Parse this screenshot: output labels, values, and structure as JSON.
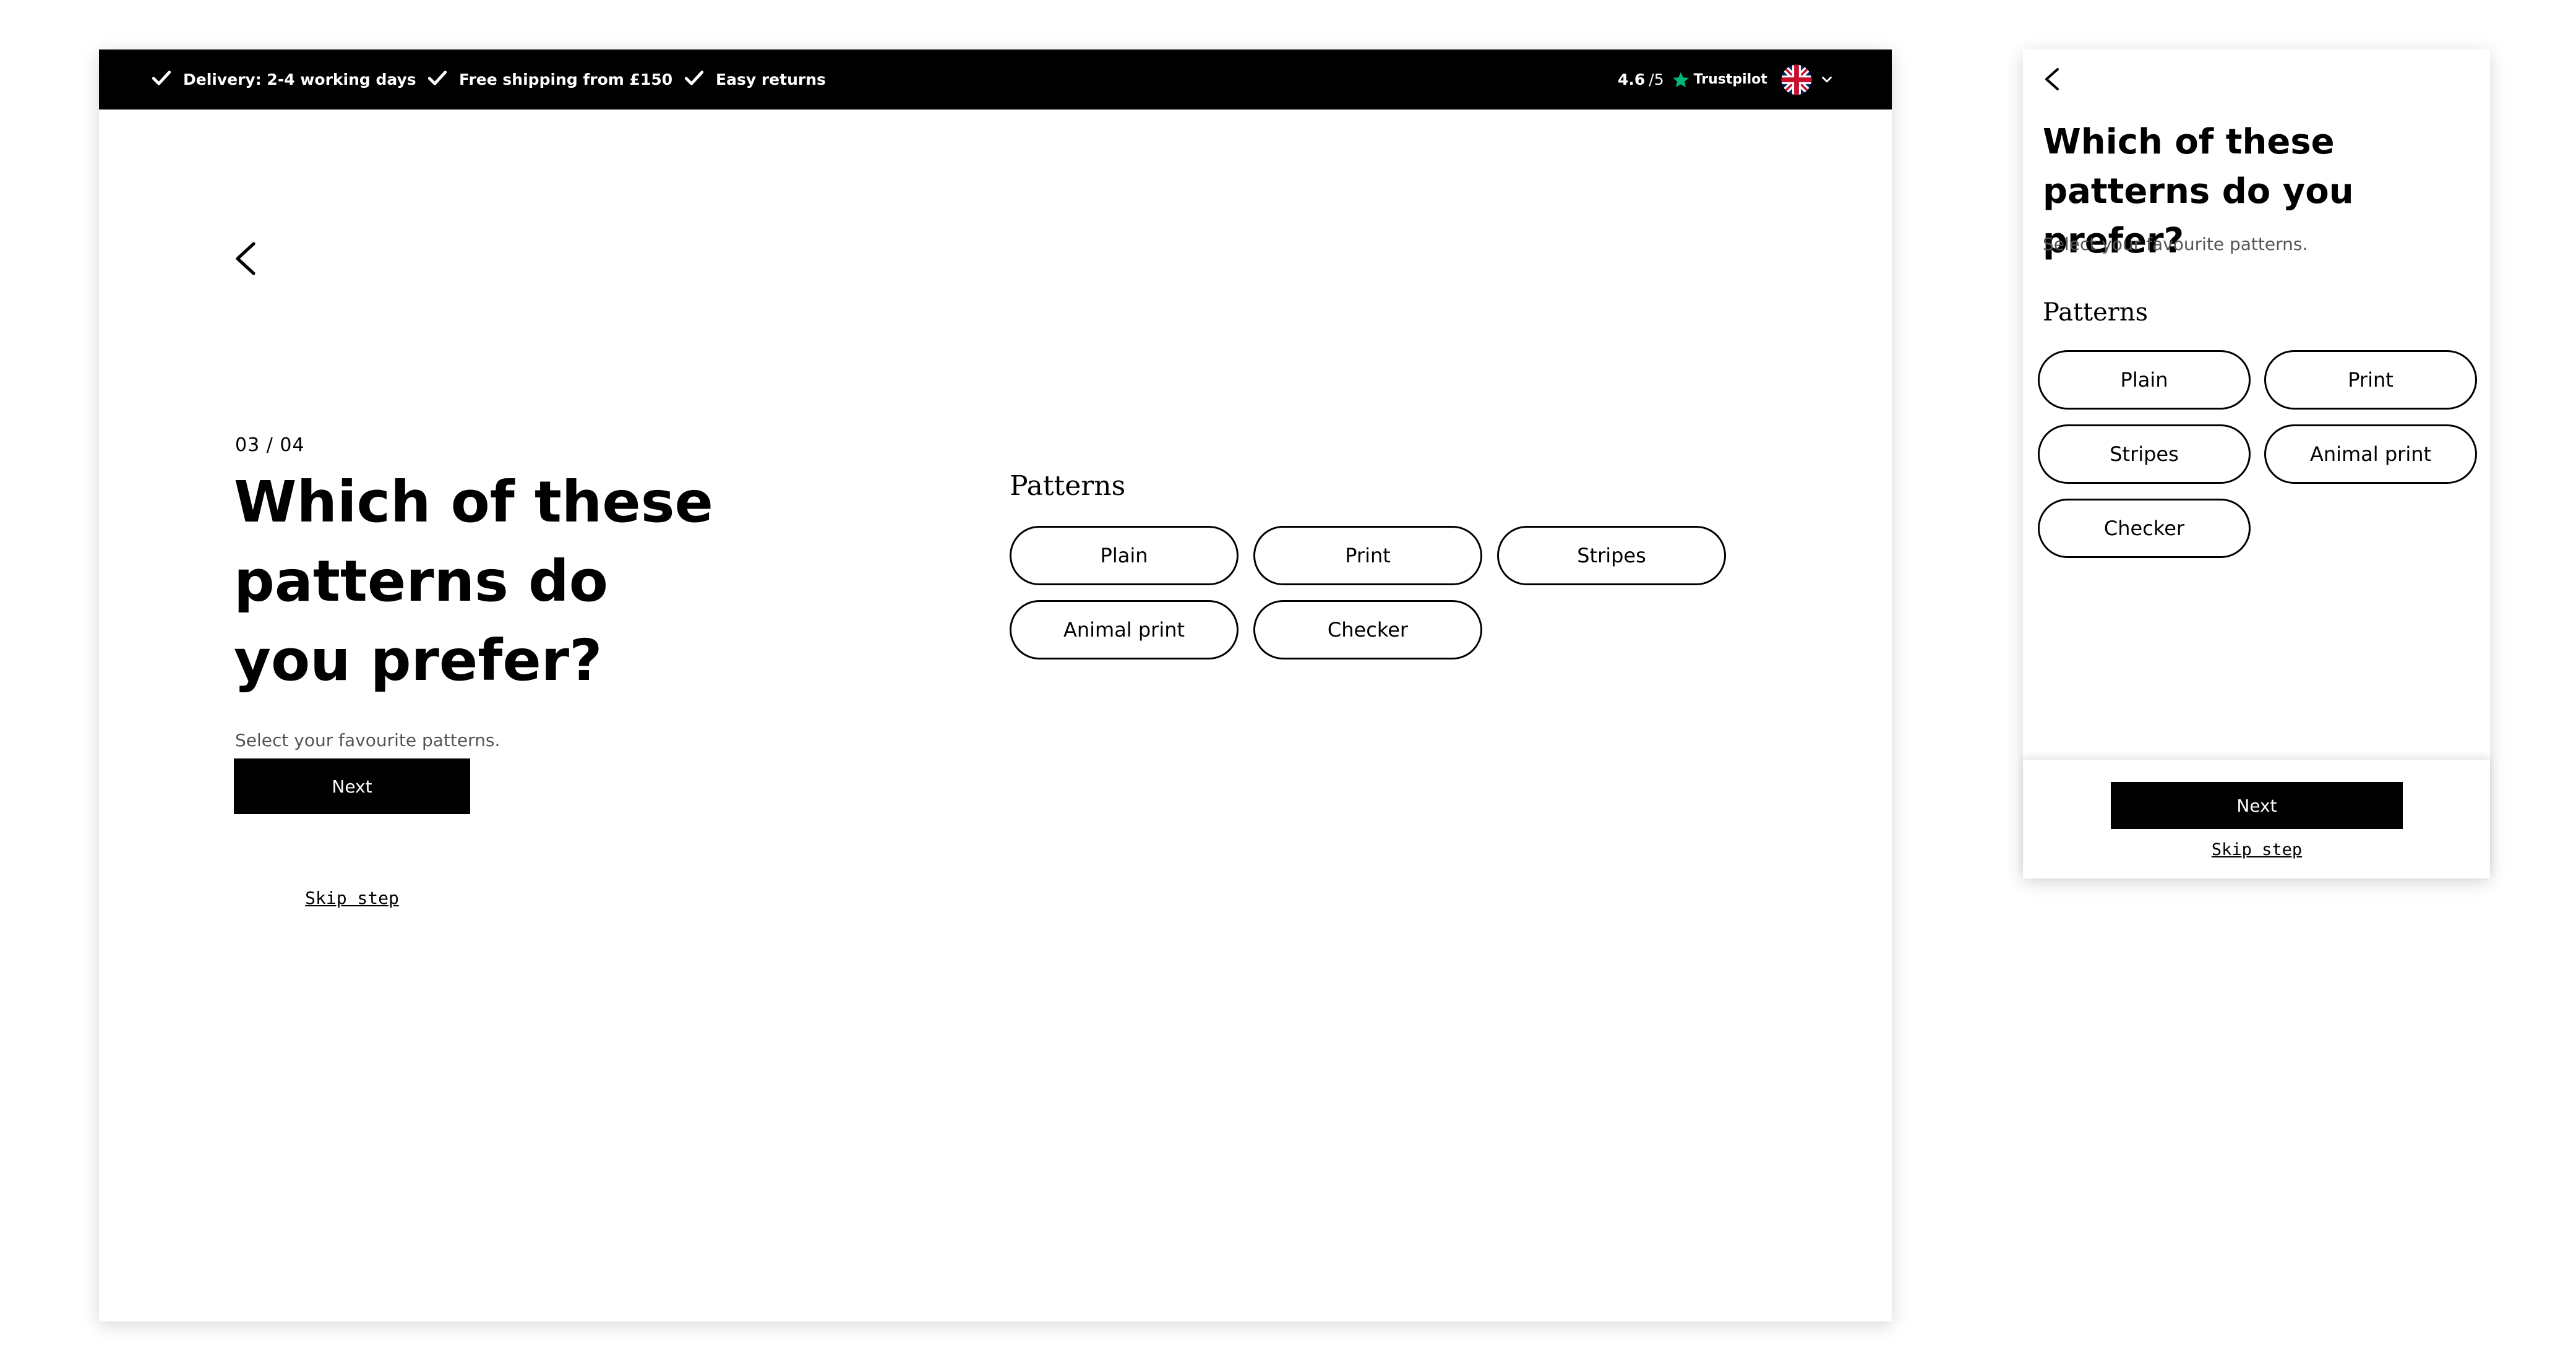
{
  "topbar": {
    "usps": [
      "Delivery: 2-4 working days",
      "Free shipping from £150",
      "Easy returns"
    ],
    "rating": {
      "score": "4.6",
      "out_of": "/5",
      "provider": "Trustpilot"
    },
    "language_flag": "uk-flag-icon",
    "colors": {
      "background": "#000000",
      "text": "#ffffff",
      "trustpilot_star": "#00b67a"
    }
  },
  "quiz": {
    "step": "03 / 04",
    "title": "Which of these patterns do you prefer?",
    "subtitle": "Select your favourite patterns.",
    "group_label": "Patterns",
    "options": [
      "Plain",
      "Print",
      "Stripes",
      "Animal print",
      "Checker"
    ],
    "next_label": "Next",
    "skip_label": "Skip step"
  },
  "icons": {
    "back": "chevron-left-icon",
    "check": "check-icon",
    "star": "star-icon",
    "dropdown": "chevron-down-icon"
  }
}
